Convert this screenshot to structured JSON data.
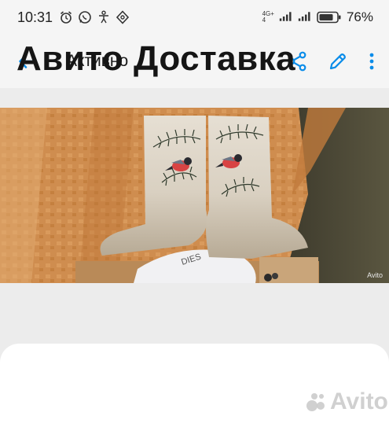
{
  "status_bar": {
    "time": "10:31",
    "network_top": "4G+",
    "network_bottom": "4",
    "battery": "76",
    "battery_unit": "%",
    "icons": [
      "alarm-icon",
      "whatsapp-icon",
      "accessibility-icon",
      "pinwheel-icon",
      "signal-icon",
      "signal-icon",
      "battery-icon"
    ]
  },
  "app_bar": {
    "title": "Активно",
    "back_icon": "arrow-left-icon",
    "actions": [
      "share-icon",
      "edit-icon",
      "more-vert-icon"
    ]
  },
  "photo": {
    "watermark": "Avito",
    "bag_text": "DIES"
  },
  "card": {
    "title": "Авито Доставка",
    "watermark": "Avito"
  },
  "colors": {
    "accent": "#0a8ce9",
    "background": "#ececec",
    "card": "#ffffff",
    "bar": "#f5f5f5"
  }
}
